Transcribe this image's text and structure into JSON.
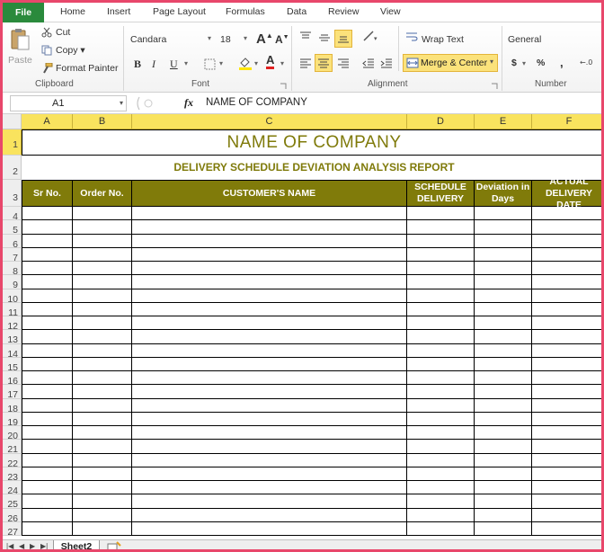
{
  "ribbon_tabs": [
    "File",
    "Home",
    "Insert",
    "Page Layout",
    "Formulas",
    "Data",
    "Review",
    "View"
  ],
  "clipboard": {
    "paste": "Paste",
    "cut": "Cut",
    "copy": "Copy",
    "format_painter": "Format Painter",
    "group_label": "Clipboard"
  },
  "font": {
    "name": "Candara",
    "size": "18",
    "bold": "B",
    "italic": "I",
    "underline": "U",
    "group_label": "Font",
    "grow": "A",
    "shrink": "A",
    "font_color_letter": "A"
  },
  "alignment": {
    "wrap_text": "Wrap Text",
    "merge_center": "Merge & Center",
    "group_label": "Alignment"
  },
  "number": {
    "format": "General",
    "currency": "$",
    "percent": "%",
    "comma": ",",
    "group_label": "Number"
  },
  "formula_bar": {
    "name_box": "A1",
    "fx": "fx",
    "formula": "NAME OF COMPANY"
  },
  "columns": [
    "A",
    "B",
    "C",
    "D",
    "E",
    "F"
  ],
  "sheet": {
    "company": "NAME OF COMPANY",
    "report_title": "DELIVERY SCHEDULE DEVIATION ANALYSIS REPORT",
    "headers": [
      "Sr No.",
      "Order No.",
      "CUSTOMER'S NAME",
      "SCHEDULE DELIVERY",
      "Deviation in Days",
      "ACTUAL DELIVERY DATE"
    ]
  },
  "rows": [
    "1",
    "2",
    "3",
    "4",
    "5",
    "6",
    "7",
    "8",
    "9",
    "10",
    "11",
    "12",
    "13",
    "14",
    "15",
    "16",
    "17",
    "18",
    "19",
    "20",
    "21",
    "22",
    "23",
    "24",
    "25",
    "26",
    "27"
  ],
  "sheet_tabs": [
    "Sheet2"
  ],
  "colors": {
    "title_olive": "#7f7a0a",
    "header_fill": "#807b0a",
    "selection_yellow": "#f9e35e",
    "file_tab": "#2a8a3c"
  }
}
